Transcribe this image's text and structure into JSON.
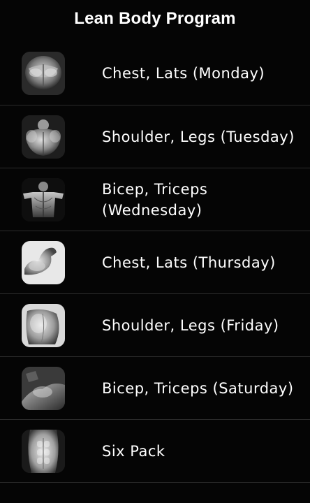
{
  "header": {
    "title": "Lean Body Program"
  },
  "workouts": [
    {
      "label": "Chest, Lats (Monday)",
      "icon": "chest-muscle-icon"
    },
    {
      "label": "Shoulder, Legs (Tuesday)",
      "icon": "shoulder-muscle-icon"
    },
    {
      "label": "Bicep, Triceps (Wednesday)",
      "icon": "back-muscle-icon"
    },
    {
      "label": "Chest, Lats (Thursday)",
      "icon": "bicep-flex-icon"
    },
    {
      "label": "Shoulder, Legs (Friday)",
      "icon": "shoulder-side-icon"
    },
    {
      "label": "Bicep, Triceps (Saturday)",
      "icon": "arm-curl-icon"
    },
    {
      "label": "Six Pack",
      "icon": "abs-icon"
    }
  ]
}
